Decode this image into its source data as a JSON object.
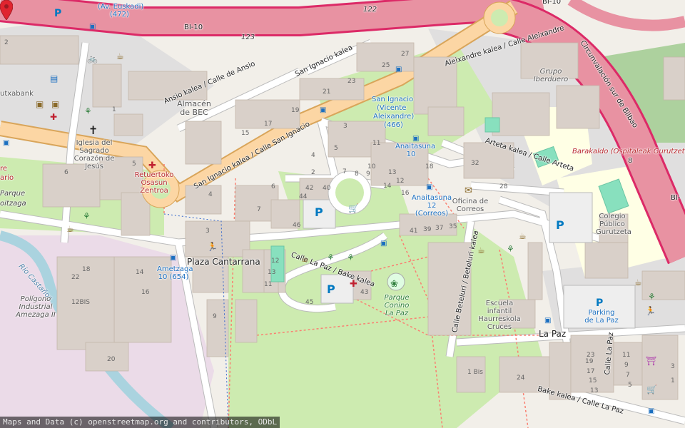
{
  "map": {
    "attribution": "Maps and Data (c) openstreetmap.org and contributors, ODbL",
    "road_labels": {
      "bi10_left": "BI-10",
      "bi10_right": "BI-10",
      "bi10_far_right": "BI-",
      "ref_122": "122",
      "ref_123": "123",
      "ref_8": "8",
      "ansio": "Ansio kalea / Calle de Ansio",
      "san_ignacio_main": "San Ignacio kalea / Calle San Ignacio",
      "san_ignacio_kalea": "San Ignacio kalea",
      "aleixandre": "Aleixandre kalea / Calle Aleixandre",
      "arteta": "Arteta kalea / Calle Arteta",
      "circunvalacion": "Circunvalación sur de Bilbao",
      "la_paz": "Calle La Paz / Bake kalea",
      "beteluri": "Calle Beteluri / Beteluri kalea",
      "bake_bottom": "Bake kalea / Calle La Paz",
      "calle_la_paz_vertical": "Calle La Paz",
      "rio_castanos": "Río Castaños",
      "bilbao": "Bilbao"
    },
    "places": {
      "plaza_cantarrana": "Plaza Cantarrana",
      "la_paz": "La Paz",
      "almacen_bec": "Almacén de BEC",
      "iglesia": "Iglesia del Sagrado Corazón de Jesús",
      "retuertoko": "Retuertoko Osasun Zentroa",
      "poligono": "Polígono Industrial Amezaga II",
      "parque_conino": "Parque Conino La Paz",
      "grupo_iberduero": "Grupo Iberduero",
      "oficina_correos": "Oficina de Correos",
      "colegio": "Colegio Público Gurutzeta",
      "escuela": "Escuela infantil Haurreskola Cruces",
      "parking_la_paz": "Parking de La Paz",
      "barakaldo": "Barakaldo (Ospitaleak Gurutzeta",
      "parque_left": "Parque",
      "oitzaga": "oitzaga",
      "kutxabank": "utxabank",
      "rio_ario": "ario",
      "rio_re": "re"
    },
    "bus_stops": {
      "euskadi": "(Av. Euskadi)",
      "n472": "(472)",
      "san_ignacio": "San Ignacio",
      "vicente": "(Vicente",
      "aleixandre": "Aleixandre)",
      "n466": "(466)",
      "anaitasuna10": "Anaitasuna 10",
      "anaitasuna12": "Anaitasuna 12 (Correos)",
      "ametzaga": "Ametzaga 10 (654)"
    },
    "house_numbers": [
      "27",
      "25",
      "21",
      "23",
      "19",
      "17",
      "15",
      "3",
      "4",
      "5",
      "7",
      "8",
      "9",
      "11",
      "10",
      "13",
      "12",
      "14",
      "16",
      "18",
      "2",
      "6",
      "42",
      "40",
      "44",
      "46",
      "41",
      "39",
      "37",
      "35",
      "32",
      "28",
      "43",
      "45",
      "14",
      "16",
      "18",
      "12BIS",
      "20",
      "22",
      "12",
      "13",
      "11",
      "9",
      "7",
      "6",
      "5",
      "4",
      "3",
      "2",
      "1",
      "1 Bis",
      "24",
      "23",
      "19",
      "17",
      "15",
      "13",
      "11",
      "9",
      "7",
      "5",
      "3",
      "1"
    ],
    "colors": {
      "motorway": "#e892a2",
      "motorway_casing": "#dc2a67",
      "primary": "#fcd6a4",
      "residential": "#ffffff",
      "park": "#c8facc",
      "green": "#add19e",
      "water": "#aad3df",
      "building": "#d9d0c9",
      "industrial": "#ebdbe8",
      "pin": "#e0242f",
      "bus": "#1b6fc0",
      "parking": "#0079c1"
    }
  }
}
